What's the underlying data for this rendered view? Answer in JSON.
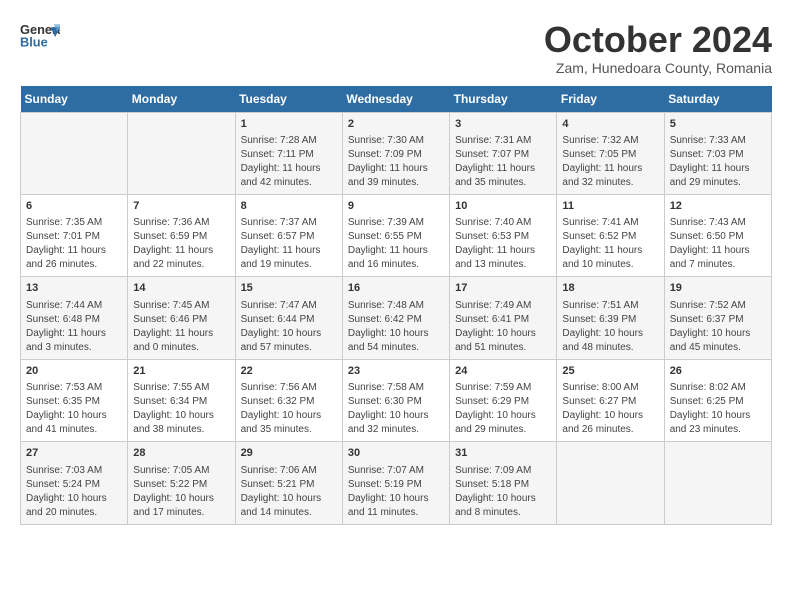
{
  "header": {
    "logo_general": "General",
    "logo_blue": "Blue",
    "title": "October 2024",
    "subtitle": "Zam, Hunedoara County, Romania"
  },
  "days_of_week": [
    "Sunday",
    "Monday",
    "Tuesday",
    "Wednesday",
    "Thursday",
    "Friday",
    "Saturday"
  ],
  "weeks": [
    [
      {
        "day": "",
        "content": ""
      },
      {
        "day": "",
        "content": ""
      },
      {
        "day": "1",
        "content": "Sunrise: 7:28 AM\nSunset: 7:11 PM\nDaylight: 11 hours and 42 minutes."
      },
      {
        "day": "2",
        "content": "Sunrise: 7:30 AM\nSunset: 7:09 PM\nDaylight: 11 hours and 39 minutes."
      },
      {
        "day": "3",
        "content": "Sunrise: 7:31 AM\nSunset: 7:07 PM\nDaylight: 11 hours and 35 minutes."
      },
      {
        "day": "4",
        "content": "Sunrise: 7:32 AM\nSunset: 7:05 PM\nDaylight: 11 hours and 32 minutes."
      },
      {
        "day": "5",
        "content": "Sunrise: 7:33 AM\nSunset: 7:03 PM\nDaylight: 11 hours and 29 minutes."
      }
    ],
    [
      {
        "day": "6",
        "content": "Sunrise: 7:35 AM\nSunset: 7:01 PM\nDaylight: 11 hours and 26 minutes."
      },
      {
        "day": "7",
        "content": "Sunrise: 7:36 AM\nSunset: 6:59 PM\nDaylight: 11 hours and 22 minutes."
      },
      {
        "day": "8",
        "content": "Sunrise: 7:37 AM\nSunset: 6:57 PM\nDaylight: 11 hours and 19 minutes."
      },
      {
        "day": "9",
        "content": "Sunrise: 7:39 AM\nSunset: 6:55 PM\nDaylight: 11 hours and 16 minutes."
      },
      {
        "day": "10",
        "content": "Sunrise: 7:40 AM\nSunset: 6:53 PM\nDaylight: 11 hours and 13 minutes."
      },
      {
        "day": "11",
        "content": "Sunrise: 7:41 AM\nSunset: 6:52 PM\nDaylight: 11 hours and 10 minutes."
      },
      {
        "day": "12",
        "content": "Sunrise: 7:43 AM\nSunset: 6:50 PM\nDaylight: 11 hours and 7 minutes."
      }
    ],
    [
      {
        "day": "13",
        "content": "Sunrise: 7:44 AM\nSunset: 6:48 PM\nDaylight: 11 hours and 3 minutes."
      },
      {
        "day": "14",
        "content": "Sunrise: 7:45 AM\nSunset: 6:46 PM\nDaylight: 11 hours and 0 minutes."
      },
      {
        "day": "15",
        "content": "Sunrise: 7:47 AM\nSunset: 6:44 PM\nDaylight: 10 hours and 57 minutes."
      },
      {
        "day": "16",
        "content": "Sunrise: 7:48 AM\nSunset: 6:42 PM\nDaylight: 10 hours and 54 minutes."
      },
      {
        "day": "17",
        "content": "Sunrise: 7:49 AM\nSunset: 6:41 PM\nDaylight: 10 hours and 51 minutes."
      },
      {
        "day": "18",
        "content": "Sunrise: 7:51 AM\nSunset: 6:39 PM\nDaylight: 10 hours and 48 minutes."
      },
      {
        "day": "19",
        "content": "Sunrise: 7:52 AM\nSunset: 6:37 PM\nDaylight: 10 hours and 45 minutes."
      }
    ],
    [
      {
        "day": "20",
        "content": "Sunrise: 7:53 AM\nSunset: 6:35 PM\nDaylight: 10 hours and 41 minutes."
      },
      {
        "day": "21",
        "content": "Sunrise: 7:55 AM\nSunset: 6:34 PM\nDaylight: 10 hours and 38 minutes."
      },
      {
        "day": "22",
        "content": "Sunrise: 7:56 AM\nSunset: 6:32 PM\nDaylight: 10 hours and 35 minutes."
      },
      {
        "day": "23",
        "content": "Sunrise: 7:58 AM\nSunset: 6:30 PM\nDaylight: 10 hours and 32 minutes."
      },
      {
        "day": "24",
        "content": "Sunrise: 7:59 AM\nSunset: 6:29 PM\nDaylight: 10 hours and 29 minutes."
      },
      {
        "day": "25",
        "content": "Sunrise: 8:00 AM\nSunset: 6:27 PM\nDaylight: 10 hours and 26 minutes."
      },
      {
        "day": "26",
        "content": "Sunrise: 8:02 AM\nSunset: 6:25 PM\nDaylight: 10 hours and 23 minutes."
      }
    ],
    [
      {
        "day": "27",
        "content": "Sunrise: 7:03 AM\nSunset: 5:24 PM\nDaylight: 10 hours and 20 minutes."
      },
      {
        "day": "28",
        "content": "Sunrise: 7:05 AM\nSunset: 5:22 PM\nDaylight: 10 hours and 17 minutes."
      },
      {
        "day": "29",
        "content": "Sunrise: 7:06 AM\nSunset: 5:21 PM\nDaylight: 10 hours and 14 minutes."
      },
      {
        "day": "30",
        "content": "Sunrise: 7:07 AM\nSunset: 5:19 PM\nDaylight: 10 hours and 11 minutes."
      },
      {
        "day": "31",
        "content": "Sunrise: 7:09 AM\nSunset: 5:18 PM\nDaylight: 10 hours and 8 minutes."
      },
      {
        "day": "",
        "content": ""
      },
      {
        "day": "",
        "content": ""
      }
    ]
  ]
}
